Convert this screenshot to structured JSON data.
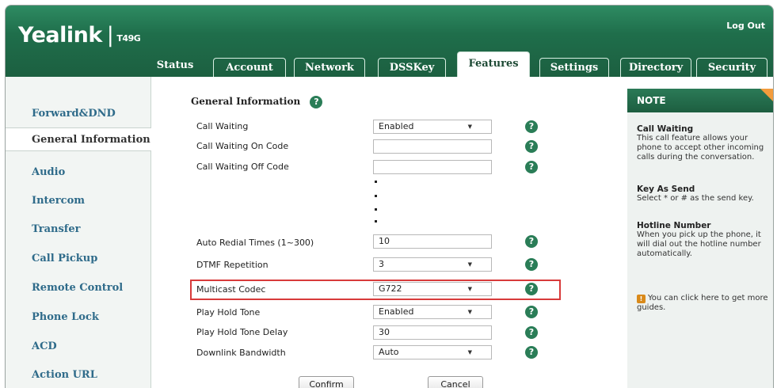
{
  "brand": {
    "name": "Yealink",
    "model": "T49G"
  },
  "header": {
    "logout_label": "Log Out"
  },
  "tabs": [
    {
      "label": "Status"
    },
    {
      "label": "Account"
    },
    {
      "label": "Network"
    },
    {
      "label": "DSSKey"
    },
    {
      "label": "Features"
    },
    {
      "label": "Settings"
    },
    {
      "label": "Directory"
    },
    {
      "label": "Security"
    }
  ],
  "sidebar": {
    "items": [
      {
        "label": "Forward&DND"
      },
      {
        "label": "General Information"
      },
      {
        "label": "Audio"
      },
      {
        "label": "Intercom"
      },
      {
        "label": "Transfer"
      },
      {
        "label": "Call Pickup"
      },
      {
        "label": "Remote Control"
      },
      {
        "label": "Phone Lock"
      },
      {
        "label": "ACD"
      },
      {
        "label": "Action URL"
      }
    ]
  },
  "section": {
    "title": "General Information"
  },
  "fields": [
    {
      "label": "Call Waiting",
      "value": "Enabled",
      "type": "select"
    },
    {
      "label": "Call Waiting On Code",
      "value": "",
      "type": "text"
    },
    {
      "label": "Call Waiting Off Code",
      "value": "",
      "type": "text"
    },
    {
      "label": "Auto Redial Times (1~300)",
      "value": "10",
      "type": "text"
    },
    {
      "label": "DTMF Repetition",
      "value": "3",
      "type": "select"
    },
    {
      "label": "Multicast Codec",
      "value": "G722",
      "type": "select"
    },
    {
      "label": "Play Hold Tone",
      "value": "Enabled",
      "type": "select"
    },
    {
      "label": "Play Hold Tone Delay",
      "value": "30",
      "type": "text"
    },
    {
      "label": "Downlink Bandwidth",
      "value": "Auto",
      "type": "select"
    }
  ],
  "buttons": {
    "confirm": "Confirm",
    "cancel": "Cancel"
  },
  "note": {
    "title": "NOTE",
    "blocks": [
      {
        "title": "Call Waiting",
        "text": "This call feature allows your phone to accept other incoming calls during the conversation."
      },
      {
        "title": "Key As Send",
        "text": "Select * or # as the send key."
      },
      {
        "title": "Hotline Number",
        "text": "When you pick up the phone, it will dial out the hotline number automatically."
      }
    ],
    "guide_text": "You can click here to get more guides."
  },
  "colors": {
    "header": "#1f6e4b",
    "link": "#2f6b8a",
    "highlight": "#d83a3a",
    "note_corner": "#f39c3c"
  },
  "icons": {
    "help": "question-circle-icon",
    "caret": "caret-down-icon",
    "guide": "book-icon"
  }
}
